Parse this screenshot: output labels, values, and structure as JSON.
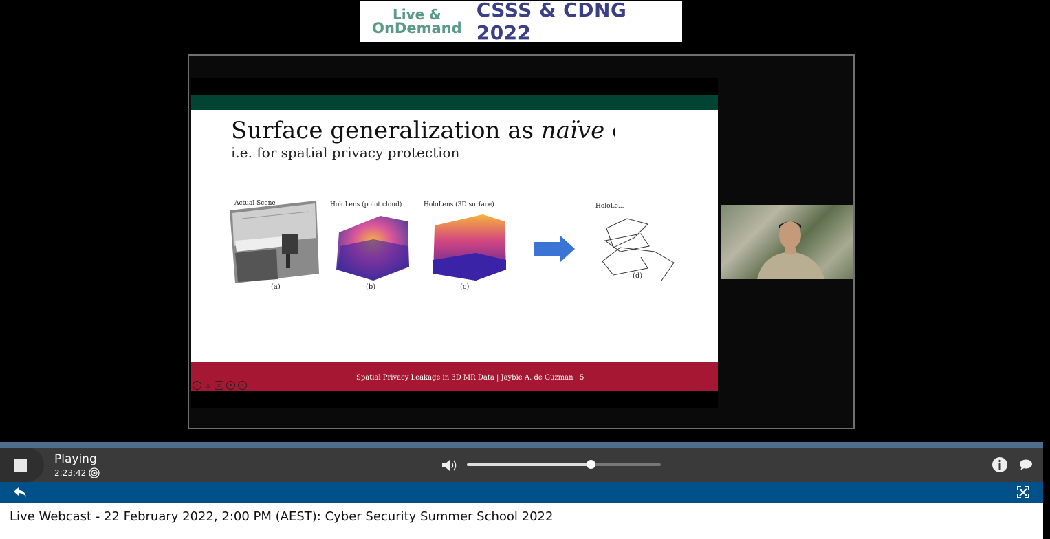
{
  "banner": {
    "logo_line1": "Live &",
    "logo_line2": "OnDemand",
    "event_title": "CSSS & CDNG 2022"
  },
  "slide": {
    "title_plain": "Surface generalization as ",
    "title_italic": "naïve",
    "title_rest": " defe",
    "subtitle": "i.e. for spatial privacy protection",
    "figures": [
      {
        "label": "Actual Scene",
        "caption": "(a)"
      },
      {
        "label": "HoloLens (point cloud)",
        "caption": "(b)"
      },
      {
        "label": "HoloLens (3D surface)",
        "caption": "(c)"
      },
      {
        "label": "HoloLe...",
        "caption": "(d)"
      }
    ],
    "footer": "Spatial Privacy Leakage in 3D MR Data | Jaybie A. de Guzman",
    "page_number": "5"
  },
  "player": {
    "status": "Playing",
    "time": "2:23:42",
    "volume": 0.64
  },
  "info": {
    "webcast_title": "Live Webcast - 22 February 2022, 2:00 PM (AEST): Cyber Security Summer School 2022"
  },
  "colors": {
    "slide_green": "#014434",
    "slide_red": "#a51732",
    "player_blue": "#00508a",
    "banner_navy": "#3a3f86",
    "banner_green": "#5b9a84"
  }
}
